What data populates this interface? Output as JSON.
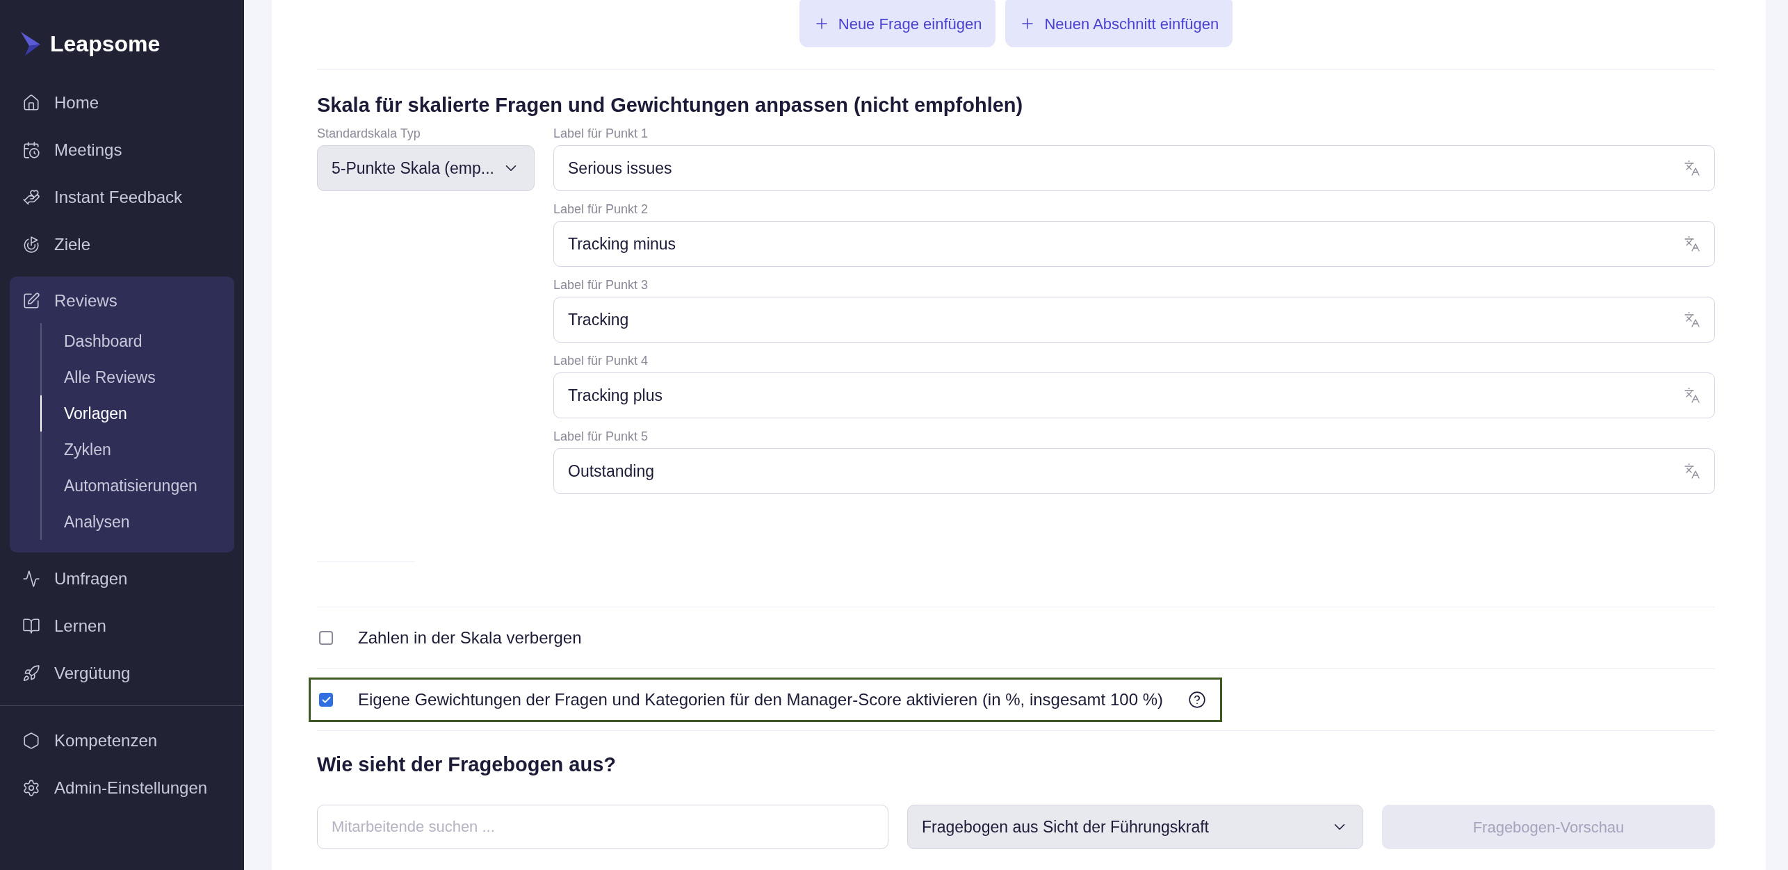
{
  "sidebar": {
    "logo": "Leapsome",
    "groups": [
      [
        {
          "label": "Home",
          "selected": false,
          "expanded": false
        },
        {
          "label": "Meetings",
          "selected": false,
          "expanded": false
        },
        {
          "label": "Instant Feedback",
          "selected": false,
          "expanded": false
        },
        {
          "label": "Ziele",
          "selected": false,
          "expanded": false
        },
        {
          "label": "Reviews",
          "selected": false,
          "expanded": true,
          "children": [
            {
              "label": "Dashboard",
              "selected": false
            },
            {
              "label": "Alle Reviews",
              "selected": false
            },
            {
              "label": "Vorlagen",
              "selected": true
            },
            {
              "label": "Zyklen",
              "selected": false
            },
            {
              "label": "Automatisierungen",
              "selected": false
            },
            {
              "label": "Analysen",
              "selected": false
            }
          ]
        },
        {
          "label": "Umfragen",
          "selected": false,
          "expanded": false
        },
        {
          "label": "Lernen",
          "selected": false,
          "expanded": false
        },
        {
          "label": "Vergütung",
          "selected": false,
          "expanded": false
        }
      ],
      [
        {
          "label": "Kompetenzen",
          "selected": false,
          "expanded": false
        },
        {
          "label": "Admin-Einstellungen",
          "selected": false,
          "expanded": false
        }
      ]
    ]
  },
  "toolbar": {
    "buttons": [
      "Neue Frage einfügen",
      "Neuen Abschnitt einfügen"
    ]
  },
  "scale_section": {
    "title": "Skala für skalierte Fragen und Gewichtungen anpassen (nicht empfohlen)",
    "type_label": "Standardskala Typ",
    "type_value": "5-Punkte Skala (emp...",
    "points": [
      {
        "label": "Label für Punkt 1",
        "value": "Serious issues"
      },
      {
        "label": "Label für Punkt 2",
        "value": "Tracking minus"
      },
      {
        "label": "Label für Punkt 3",
        "value": "Tracking"
      },
      {
        "label": "Label für Punkt 4",
        "value": "Tracking plus"
      },
      {
        "label": "Label für Punkt 5",
        "value": "Outstanding"
      }
    ]
  },
  "options": [
    {
      "label": "Zahlen in der Skala verbergen",
      "checked": false,
      "highlighted": false,
      "help": false
    },
    {
      "label": "Eigene Gewichtungen der Fragen und Kategorien für den Manager-Score aktivieren (in %, insgesamt 100 %)",
      "checked": true,
      "highlighted": true,
      "help": true
    }
  ],
  "preview": {
    "title": "Wie sieht der Fragebogen aus?",
    "search": {
      "placeholder": "Mitarbeitende suchen ..."
    },
    "perspective": "Fragebogen aus Sicht der Führungskraft",
    "button": {
      "label": "Fragebogen-Vorschau",
      "disabled": true
    }
  }
}
